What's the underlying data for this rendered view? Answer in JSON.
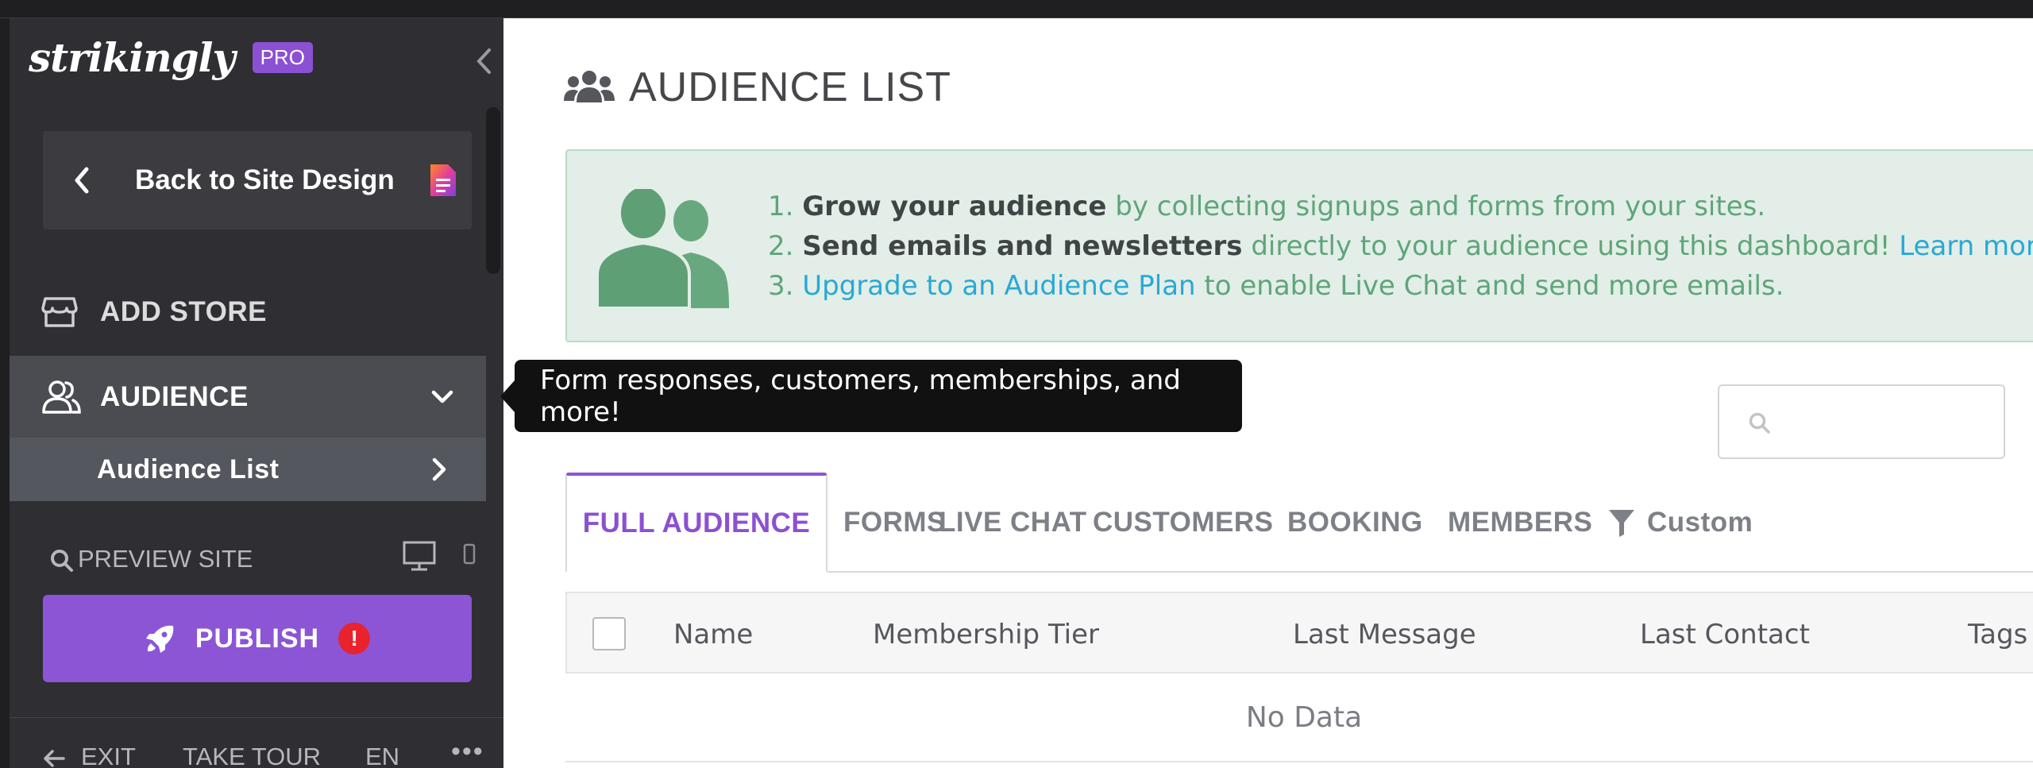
{
  "sidebar": {
    "logo": "strikingly",
    "badge": "PRO",
    "back_label": "Back to Site Design",
    "add_store": "ADD STORE",
    "audience": "AUDIENCE",
    "audience_list": "Audience List",
    "preview": "PREVIEW SITE",
    "publish": "PUBLISH",
    "publish_alert": "!",
    "footer": {
      "exit": "EXIT",
      "tour": "TAKE TOUR",
      "lang": "EN",
      "more": "•••"
    }
  },
  "main": {
    "title": "AUDIENCE LIST",
    "banner": {
      "l1_num": "1. ",
      "l1_bold": "Grow your audience",
      "l1_rest": " by collecting signups and forms from your sites.",
      "l2_num": "2. ",
      "l2_bold": "Send emails and newsletters",
      "l2_rest": " directly to your audience using this dashboard! ",
      "l2_link": "Learn more.",
      "l3_num": "3. ",
      "l3_link": "Upgrade to an Audience Plan",
      "l3_rest": " to enable Live Chat and send more emails."
    },
    "tooltip": "Form responses, customers, memberships, and more!",
    "search": {
      "placeholder": "",
      "value": ""
    },
    "tabs": [
      "FULL AUDIENCE",
      "FORMS",
      "LIVE CHAT",
      "CUSTOMERS",
      "BOOKING",
      "MEMBERS",
      "Custom"
    ],
    "columns": [
      "Name",
      "Membership Tier",
      "Last Message",
      "Last Contact",
      "Tags"
    ],
    "empty": "No Data"
  },
  "colors": {
    "accent": "#8c55d6",
    "banner_green": "#5fa57a",
    "link": "#29a8d6",
    "alert": "#e8232d"
  }
}
